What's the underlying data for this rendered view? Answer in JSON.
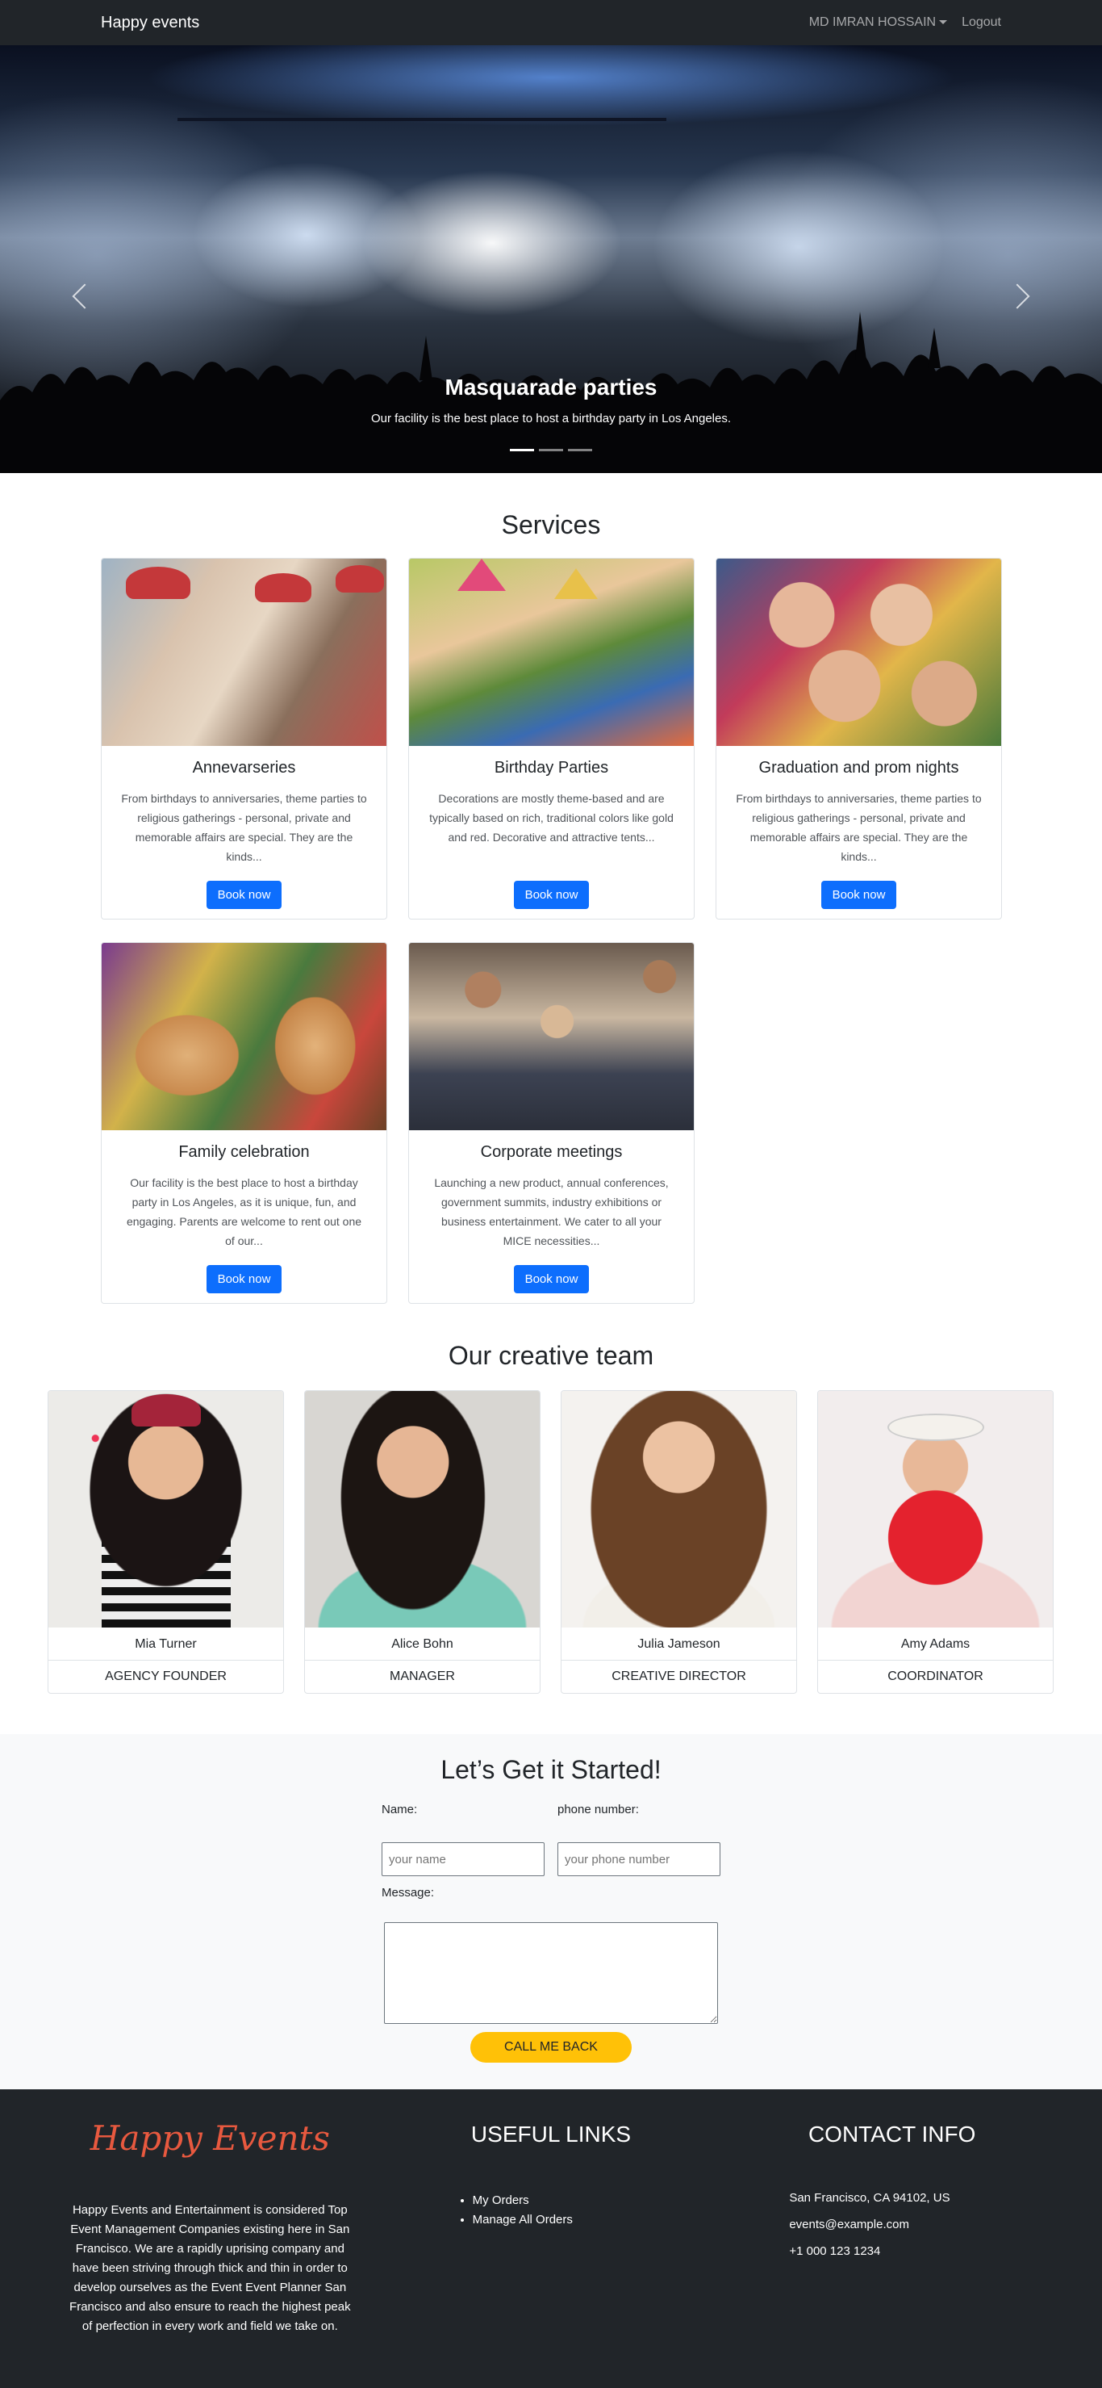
{
  "nav": {
    "brand": "Happy events",
    "user": "MD IMRAN HOSSAIN",
    "logout": "Logout"
  },
  "hero": {
    "title": "Masquarade parties",
    "subtitle": "Our facility is the best place to host a birthday party in Los Angeles.",
    "slide_count": 3,
    "active_slide": 1
  },
  "services": {
    "title": "Services",
    "cards": [
      {
        "title": "Annevarseries",
        "text": "From birthdays to anniversaries, theme parties to religious gatherings - personal, private and memorable affairs are special. They are the kinds...",
        "button": "Book now"
      },
      {
        "title": "Birthday Parties",
        "text": "Decorations are mostly theme-based and are typically based on rich, traditional colors like gold and red. Decorative and attractive tents...",
        "button": "Book now"
      },
      {
        "title": "Graduation and prom nights",
        "text": "From birthdays to anniversaries, theme parties to religious gatherings - personal, private and memorable affairs are special. They are the kinds...",
        "button": "Book now"
      },
      {
        "title": "Family celebration",
        "text": "Our facility is the best place to host a birthday party in Los Angeles, as it is unique, fun, and engaging. Parents are welcome to rent out one of our...",
        "button": "Book now"
      },
      {
        "title": "Corporate meetings",
        "text": "Launching a new product, annual conferences, government summits, industry exhibitions or business entertainment. We cater to all your MICE necessities...",
        "button": "Book now"
      }
    ]
  },
  "team": {
    "title": "Our creative team",
    "members": [
      {
        "name": "Mia Turner",
        "role": "AGENCY FOUNDER"
      },
      {
        "name": "Alice Bohn",
        "role": "MANAGER"
      },
      {
        "name": "Julia Jameson",
        "role": "CREATIVE DIRECTOR"
      },
      {
        "name": "Amy Adams",
        "role": "COORDINATOR"
      }
    ]
  },
  "contact": {
    "title": "Let’s Get it Started!",
    "name_label": "Name:",
    "name_placeholder": "your name",
    "phone_label": "phone number:",
    "phone_placeholder": "your phone number",
    "message_label": "Message:",
    "button": "CALL ME BACK"
  },
  "footer": {
    "logo_text": "Happy Events",
    "about": "Happy Events and Entertainment is considered Top Event Management Companies existing here in San Francisco. We are a rapidly uprising company and have been striving through thick and thin in order to develop ourselves as the Event Event Planner San Francisco and also ensure to reach the highest peak of perfection in every work and field we take on.",
    "links_title": "USEFUL LINKS",
    "links": [
      "My Orders",
      "Manage All Orders"
    ],
    "contact_title": "CONTACT INFO",
    "address": "San Francisco, CA 94102, US",
    "email": "events@example.com",
    "phone": "+1 000 123 1234"
  },
  "colors": {
    "navbar": "#212529",
    "primary": "#0d6efd",
    "accent": "#ffc107",
    "logo": "#e8593f"
  }
}
